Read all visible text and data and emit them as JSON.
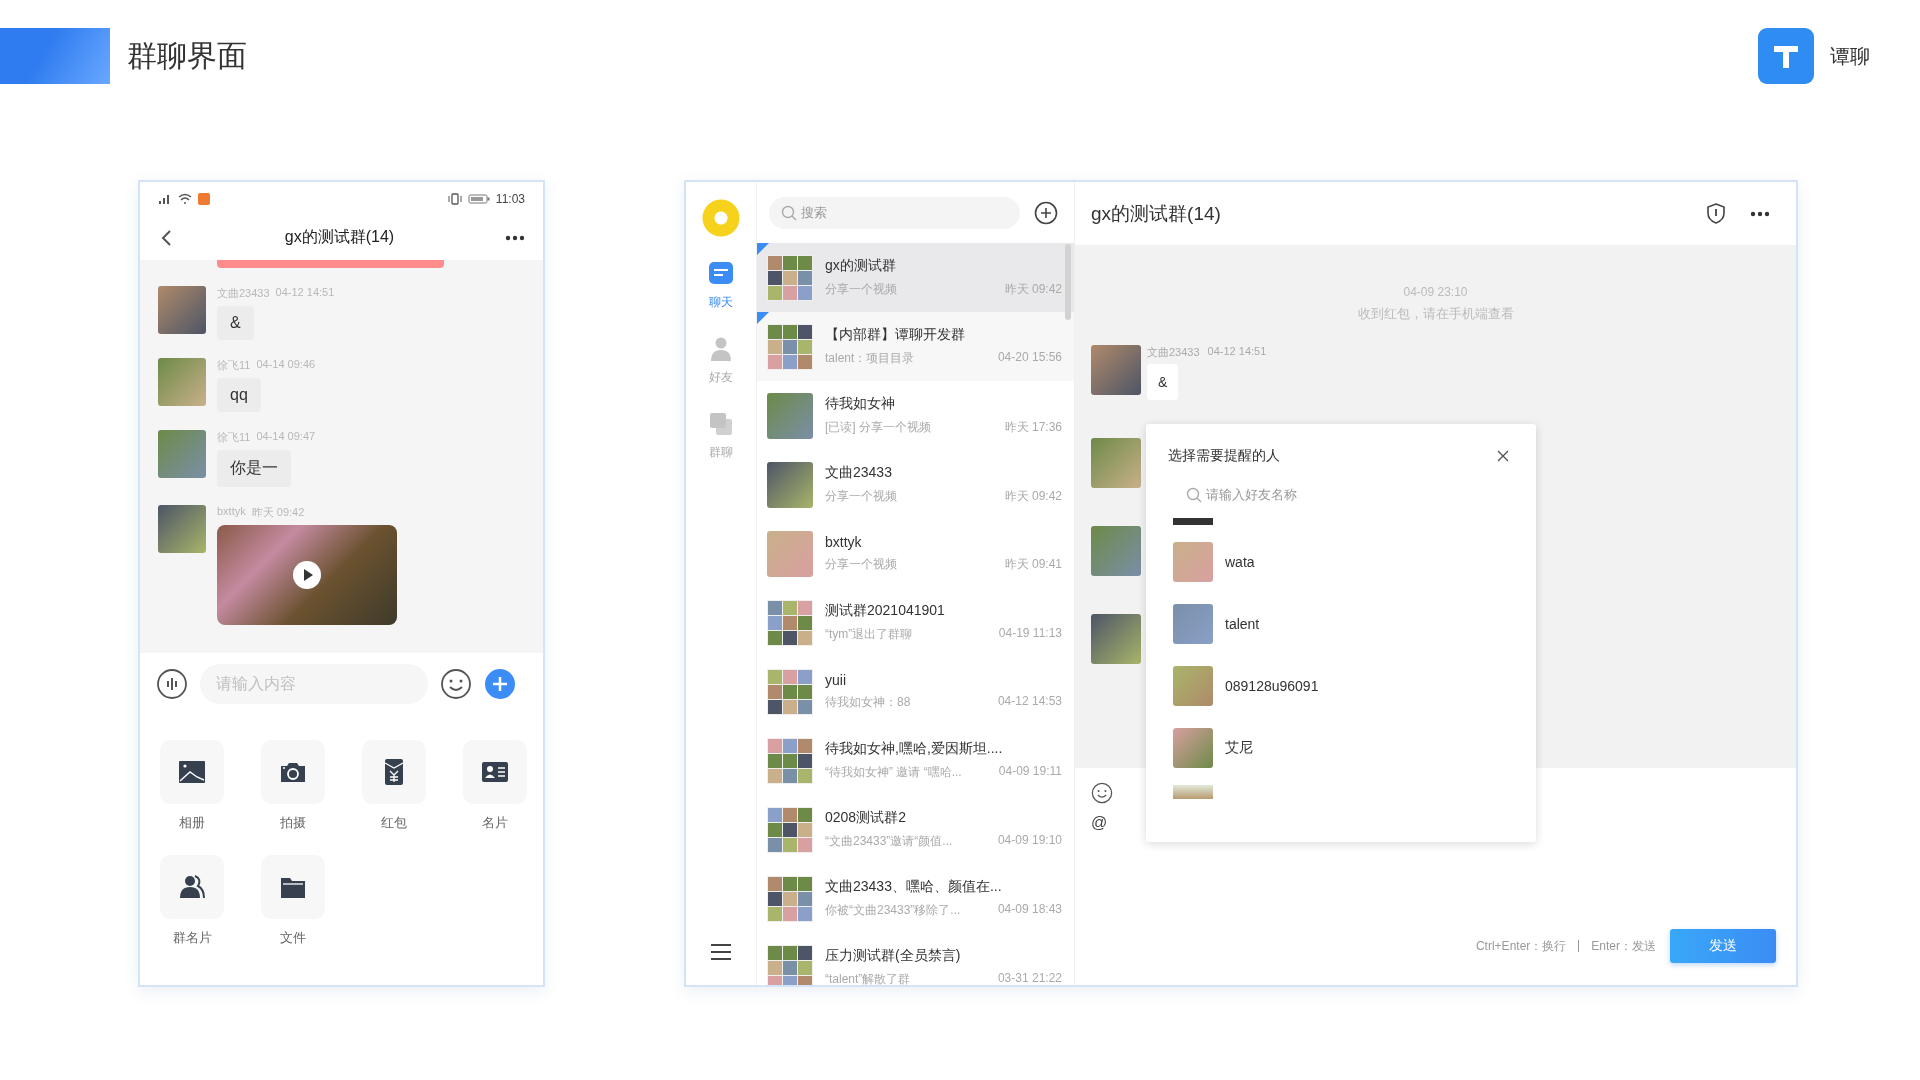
{
  "header": {
    "title": "群聊界面",
    "brand": "谭聊"
  },
  "phone": {
    "status_time": "11:03",
    "title": "gx的测试群(14)",
    "messages": [
      {
        "sender": "文曲23433",
        "time": "04-12 14:51",
        "kind": "text",
        "text": "&"
      },
      {
        "sender": "徐飞11",
        "time": "04-14 09:46",
        "kind": "text",
        "text": "qq"
      },
      {
        "sender": "徐飞11",
        "time": "04-14 09:47",
        "kind": "text",
        "text": "你是一"
      },
      {
        "sender": "bxttyk",
        "time": "昨天 09:42",
        "kind": "video"
      }
    ],
    "input": {
      "placeholder": "请输入内容"
    },
    "actions": [
      {
        "label": "相册",
        "kind": "album"
      },
      {
        "label": "拍摄",
        "kind": "camera"
      },
      {
        "label": "红包",
        "kind": "red_packet"
      },
      {
        "label": "名片",
        "kind": "card"
      },
      {
        "label": "群名片",
        "kind": "group_card"
      },
      {
        "label": "文件",
        "kind": "file"
      }
    ]
  },
  "desktop": {
    "nav": [
      {
        "label": "聊天",
        "kind": "chat",
        "selected": true
      },
      {
        "label": "好友",
        "kind": "friends",
        "selected": false
      },
      {
        "label": "群聊",
        "kind": "groups",
        "selected": false
      }
    ],
    "search": {
      "placeholder": "搜索"
    },
    "conversations": [
      {
        "name": "gx的测试群",
        "preview": "分享一个视频",
        "time": "昨天 09:42",
        "kind": "group",
        "selected": true,
        "pinned": true
      },
      {
        "name": "【内部群】谭聊开发群",
        "preview": "talent：项目目录",
        "time": "04-20 15:56",
        "kind": "group",
        "selected": false,
        "pinned": true
      },
      {
        "name": "待我如女神",
        "preview": "[已读] 分享一个视频",
        "time": "昨天 17:36",
        "kind": "person",
        "selected": false,
        "pinned": false
      },
      {
        "name": "文曲23433",
        "preview": "分享一个视频",
        "time": "昨天 09:42",
        "kind": "person",
        "selected": false,
        "pinned": false
      },
      {
        "name": "bxttyk",
        "preview": "分享一个视频",
        "time": "昨天 09:41",
        "kind": "person",
        "selected": false,
        "pinned": false
      },
      {
        "name": "测试群2021041901",
        "preview": "“tym”退出了群聊",
        "time": "04-19 11:13",
        "kind": "group",
        "selected": false,
        "pinned": false
      },
      {
        "name": "yuii",
        "preview": "待我如女神：88",
        "time": "04-12 14:53",
        "kind": "group",
        "selected": false,
        "pinned": false
      },
      {
        "name": "待我如女神,嘿哈,爱因斯坦....",
        "preview": "“待我如女神” 邀请 “嘿哈...",
        "time": "04-09 19:11",
        "kind": "group",
        "selected": false,
        "pinned": false
      },
      {
        "name": "0208测试群2",
        "preview": "“文曲23433”邀请“颜值...",
        "time": "04-09 19:10",
        "kind": "group",
        "selected": false,
        "pinned": false
      },
      {
        "name": "文曲23433、嘿哈、颜值在...",
        "preview": "你被“文曲23433”移除了...",
        "time": "04-09 18:43",
        "kind": "group",
        "selected": false,
        "pinned": false
      },
      {
        "name": "压力测试群(全员禁言)",
        "preview": "“talent”解散了群",
        "time": "03-31 21:22",
        "kind": "group",
        "selected": false,
        "pinned": false
      }
    ],
    "chat": {
      "title": "gx的测试群(14)",
      "system_time": "04-09 23:10",
      "system_text": "收到红包，请在手机端查看",
      "messages": [
        {
          "sender": "文曲23433",
          "time": "04-12 14:51",
          "text": "&"
        }
      ],
      "mention_symbol": "@",
      "hints": [
        "Ctrl+Enter：换行",
        "Enter：发送"
      ],
      "send": "发送"
    },
    "mention_popup": {
      "title": "选择需要提醒的人",
      "placeholder": "请输入好友名称",
      "members": [
        {
          "name": "wata"
        },
        {
          "name": "talent"
        },
        {
          "name": "089128u96091"
        },
        {
          "name": "艾尼"
        }
      ]
    }
  }
}
